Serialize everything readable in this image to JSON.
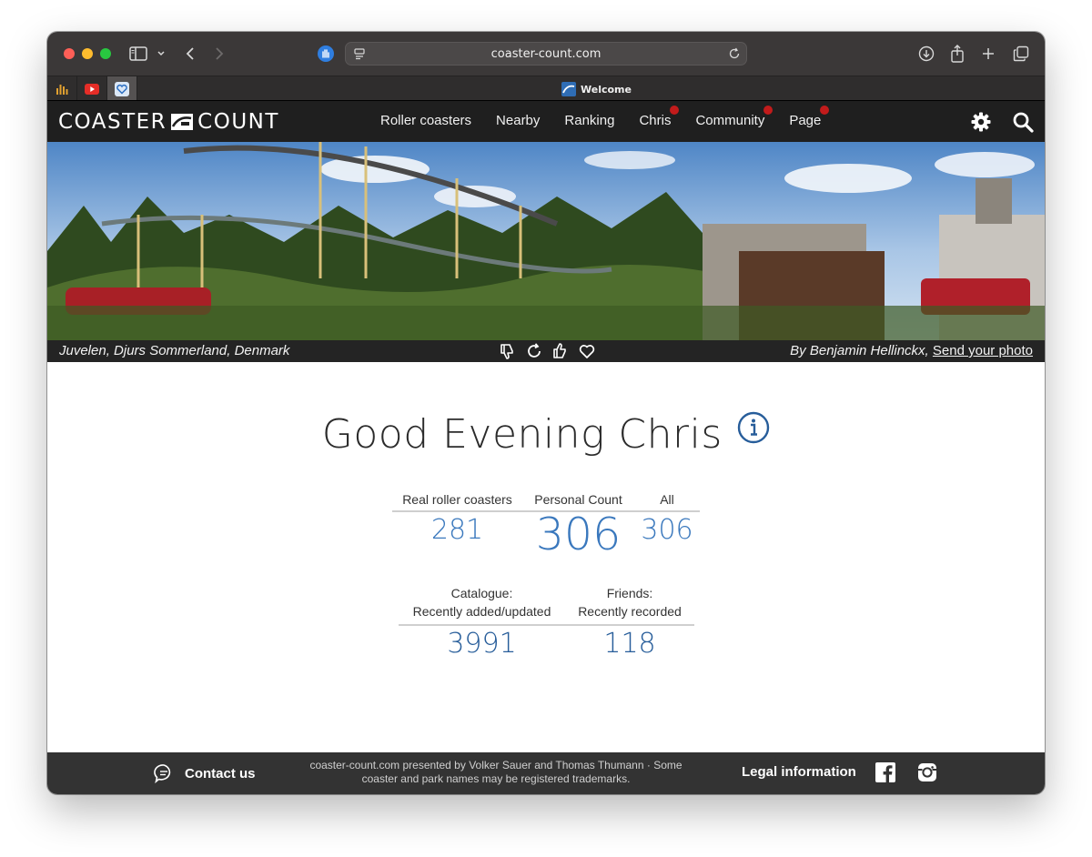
{
  "browser": {
    "url": "coaster-count.com",
    "active_tab_title": "Welcome"
  },
  "site": {
    "logo_left": "COASTER",
    "logo_right": "COUNT",
    "nav": [
      {
        "label": "Roller coasters",
        "badge": false
      },
      {
        "label": "Nearby",
        "badge": false
      },
      {
        "label": "Ranking",
        "badge": false
      },
      {
        "label": "Chris",
        "badge": true
      },
      {
        "label": "Community",
        "badge": true
      },
      {
        "label": "Page",
        "badge": true
      }
    ],
    "icons": [
      "gear-icon",
      "search-icon"
    ]
  },
  "hero": {
    "caption": "Juvelen, Djurs Sommerland, Denmark",
    "credit": "By Benjamin Hellinckx,",
    "send_photo": "Send your photo",
    "actions": [
      "thumbs-down-icon",
      "refresh-icon",
      "thumbs-up-icon",
      "heart-icon"
    ]
  },
  "greeting": "Good Evening Chris",
  "stats": {
    "real_label": "Real roller coasters",
    "real_value": "281",
    "personal_label": "Personal Count",
    "personal_value": "306",
    "all_label": "All",
    "all_value": "306",
    "catalogue_label_1": "Catalogue:",
    "catalogue_label_2": "Recently added/updated",
    "catalogue_value": "3991",
    "friends_label_1": "Friends:",
    "friends_label_2": "Recently recorded",
    "friends_value": "118"
  },
  "footer": {
    "contact": "Contact us",
    "notice": "coaster-count.com presented by Volker Sauer and Thomas Thumann · Some coaster and park names may be registered trademarks.",
    "legal": "Legal information"
  },
  "colors": {
    "stat_blue": "#3a78bd",
    "stat_dark_blue": "#275d9a",
    "badge_red": "#c21b1b",
    "nav_bg": "#1f1f1f"
  }
}
